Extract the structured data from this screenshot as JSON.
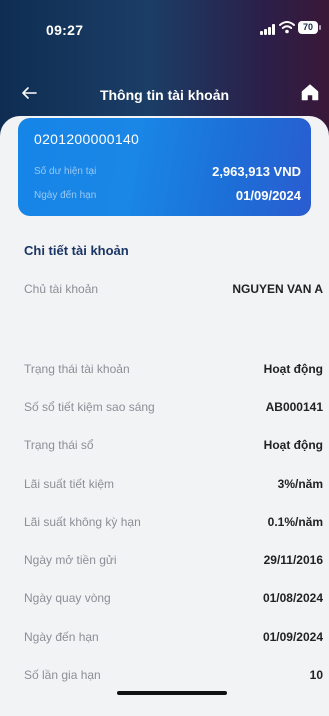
{
  "status_bar": {
    "time": "09:27",
    "battery": "70"
  },
  "header": {
    "title": "Thông tin tài khoản",
    "back_icon": "arrow-left-icon",
    "home_icon": "home-icon"
  },
  "account_card": {
    "account_number": "0201200000140",
    "balance_label": "Số dư hiện tại",
    "balance_value": "2,963,913 VND",
    "due_date_label": "Ngày đến hạn",
    "due_date_value": "01/09/2024"
  },
  "details": {
    "heading": "Chi tiết tài khoản",
    "rows": [
      {
        "label": "Chủ tài khoản",
        "value": "NGUYEN VAN A"
      },
      {
        "label": "Trạng thái tài khoản",
        "value": "Hoạt động"
      },
      {
        "label": "Số sổ tiết kiệm sao sáng",
        "value": "AB000141"
      },
      {
        "label": "Trạng thái sổ",
        "value": "Hoạt động"
      },
      {
        "label": "Lãi suất tiết kiệm",
        "value": "3%/năm"
      },
      {
        "label": "Lãi suất không kỳ hạn",
        "value": "0.1%/năm"
      },
      {
        "label": "Ngày mở tiền gửi",
        "value": "29/11/2016"
      },
      {
        "label": "Ngày quay vòng",
        "value": "01/08/2024"
      },
      {
        "label": "Ngày đến hạn",
        "value": "01/09/2024"
      },
      {
        "label": "Số lần gia hạn",
        "value": "10"
      }
    ]
  },
  "colors": {
    "card_accent": "#1685e8",
    "header_bg": "#0f2d52",
    "heading_text": "#1b3564"
  }
}
